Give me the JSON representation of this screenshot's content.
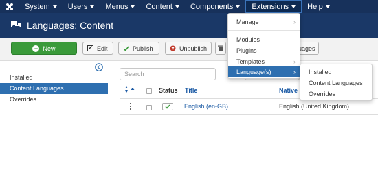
{
  "navbar": {
    "items": [
      "System",
      "Users",
      "Menus",
      "Content",
      "Components",
      "Extensions",
      "Help"
    ]
  },
  "header": {
    "title": "Languages: Content"
  },
  "toolbar": {
    "new": "New",
    "edit": "Edit",
    "publish": "Publish",
    "unpublish": "Unpublish",
    "partial": "uages"
  },
  "sidebar": {
    "items": [
      "Installed",
      "Content Languages",
      "Overrides"
    ]
  },
  "search": {
    "placeholder": "Search"
  },
  "table": {
    "headers": {
      "status": "Status",
      "title": "Title",
      "native": "Native"
    },
    "rows": [
      {
        "title": "English (en-GB)",
        "native": "English (United Kingdom)"
      }
    ]
  },
  "extensions_menu": {
    "items": [
      "Manage",
      "Modules",
      "Plugins",
      "Templates",
      "Language(s)"
    ]
  },
  "languages_submenu": {
    "items": [
      "Installed",
      "Content Languages",
      "Overrides"
    ]
  },
  "colors": {
    "navbar": "#17315b",
    "header": "#1a3867",
    "new_button": "#3a9a3a",
    "active": "#2e6fb0",
    "link": "#1c5ba5"
  }
}
